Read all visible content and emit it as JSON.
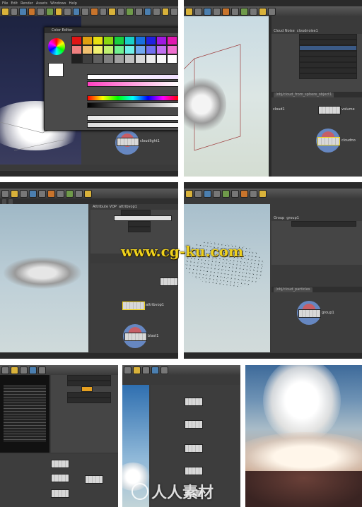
{
  "menu": [
    "File",
    "Edit",
    "Render",
    "Assets",
    "Windows",
    "Help"
  ],
  "panel1": {
    "color_editor_title": "Color Editor",
    "node_label": "cloudlight1"
  },
  "panel2": {
    "parm_title": "Cloud Noise",
    "parm_node": "cloudnoise1",
    "net_path": "/obj/cloud_from_sphere_object1",
    "node_left_label": "cloud1",
    "node_right_label": "volume",
    "node_bottom_label": "cloudno"
  },
  "panel3": {
    "parm_title": "Attribute VOP",
    "parm_node": "attribvop1",
    "node_mid_label": "attribvop1",
    "node_bottom_label": "blast1"
  },
  "panel4": {
    "parm_title": "Group",
    "parm_node": "group1",
    "net_path": "/obj/cloud_particles",
    "node_label": "group1"
  },
  "watermark": {
    "url_text": "www.cg-ku.com",
    "logo_text": "人人素材"
  },
  "colors": {
    "accent_yellow": "#f0d21c",
    "node_blue": "#6a8fd0",
    "node_red": "#d6626a",
    "ui_dark": "#3a3a3a"
  }
}
